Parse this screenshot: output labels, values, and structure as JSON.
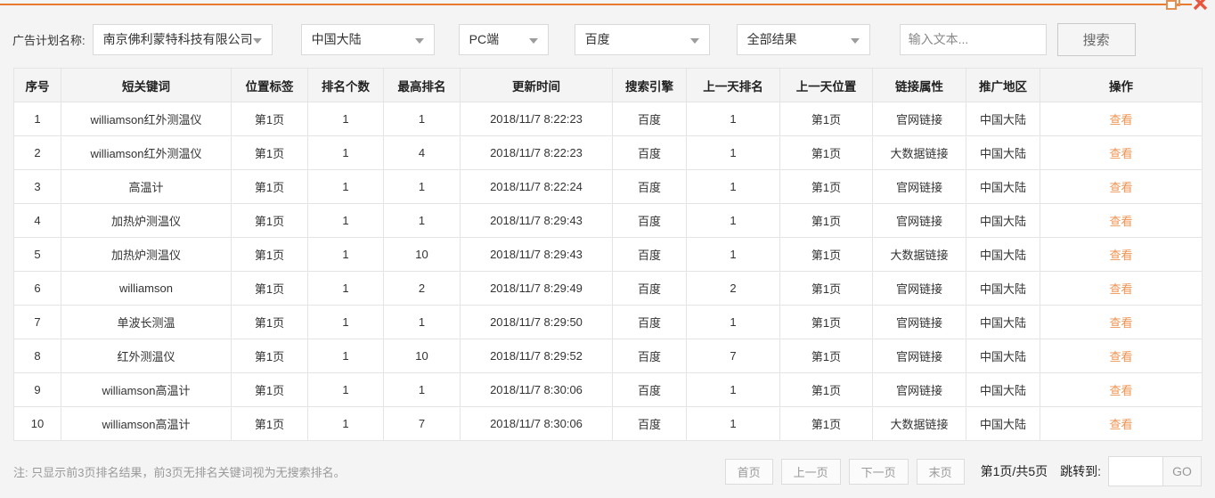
{
  "window": {
    "icons": {
      "restore": "restore-window",
      "close": "close-window"
    },
    "accent_color": "#e87a2f",
    "close_color": "#e8573d",
    "link_color": "#ef9352"
  },
  "filters": {
    "label": "广告计划名称:",
    "selects": [
      {
        "value": "南京佛利蒙特科技有限公司"
      },
      {
        "value": "中国大陆"
      },
      {
        "value": "PC端"
      },
      {
        "value": "百度"
      },
      {
        "value": "全部结果"
      }
    ],
    "input_placeholder": "输入文本...",
    "search_label": "搜索"
  },
  "table": {
    "columns": [
      "序号",
      "短关键词",
      "位置标签",
      "排名个数",
      "最高排名",
      "更新时间",
      "搜索引擎",
      "上一天排名",
      "上一天位置",
      "链接属性",
      "推广地区",
      "操作"
    ],
    "action_label": "查看",
    "rows": [
      [
        "1",
        "williamson红外测温仪",
        "第1页",
        "1",
        "1",
        "2018/11/7 8:22:23",
        "百度",
        "1",
        "第1页",
        "官网链接",
        "中国大陆"
      ],
      [
        "2",
        "williamson红外测温仪",
        "第1页",
        "1",
        "4",
        "2018/11/7 8:22:23",
        "百度",
        "1",
        "第1页",
        "大数据链接",
        "中国大陆"
      ],
      [
        "3",
        "高温计",
        "第1页",
        "1",
        "1",
        "2018/11/7 8:22:24",
        "百度",
        "1",
        "第1页",
        "官网链接",
        "中国大陆"
      ],
      [
        "4",
        "加热炉测温仪",
        "第1页",
        "1",
        "1",
        "2018/11/7 8:29:43",
        "百度",
        "1",
        "第1页",
        "官网链接",
        "中国大陆"
      ],
      [
        "5",
        "加热炉测温仪",
        "第1页",
        "1",
        "10",
        "2018/11/7 8:29:43",
        "百度",
        "1",
        "第1页",
        "大数据链接",
        "中国大陆"
      ],
      [
        "6",
        "williamson",
        "第1页",
        "1",
        "2",
        "2018/11/7 8:29:49",
        "百度",
        "2",
        "第1页",
        "官网链接",
        "中国大陆"
      ],
      [
        "7",
        "单波长测温",
        "第1页",
        "1",
        "1",
        "2018/11/7 8:29:50",
        "百度",
        "1",
        "第1页",
        "官网链接",
        "中国大陆"
      ],
      [
        "8",
        "红外测温仪",
        "第1页",
        "1",
        "10",
        "2018/11/7 8:29:52",
        "百度",
        "7",
        "第1页",
        "官网链接",
        "中国大陆"
      ],
      [
        "9",
        "williamson高温计",
        "第1页",
        "1",
        "1",
        "2018/11/7 8:30:06",
        "百度",
        "1",
        "第1页",
        "官网链接",
        "中国大陆"
      ],
      [
        "10",
        "williamson高温计",
        "第1页",
        "1",
        "7",
        "2018/11/7 8:30:06",
        "百度",
        "1",
        "第1页",
        "大数据链接",
        "中国大陆"
      ]
    ]
  },
  "footer": {
    "note": "注: 只显示前3页排名结果，前3页无排名关键词视为无搜索排名。",
    "buttons": [
      "首页",
      "上一页",
      "下一页",
      "末页"
    ],
    "page_info": "第1页/共5页",
    "jump_label": "跳转到:",
    "go_label": "GO"
  }
}
